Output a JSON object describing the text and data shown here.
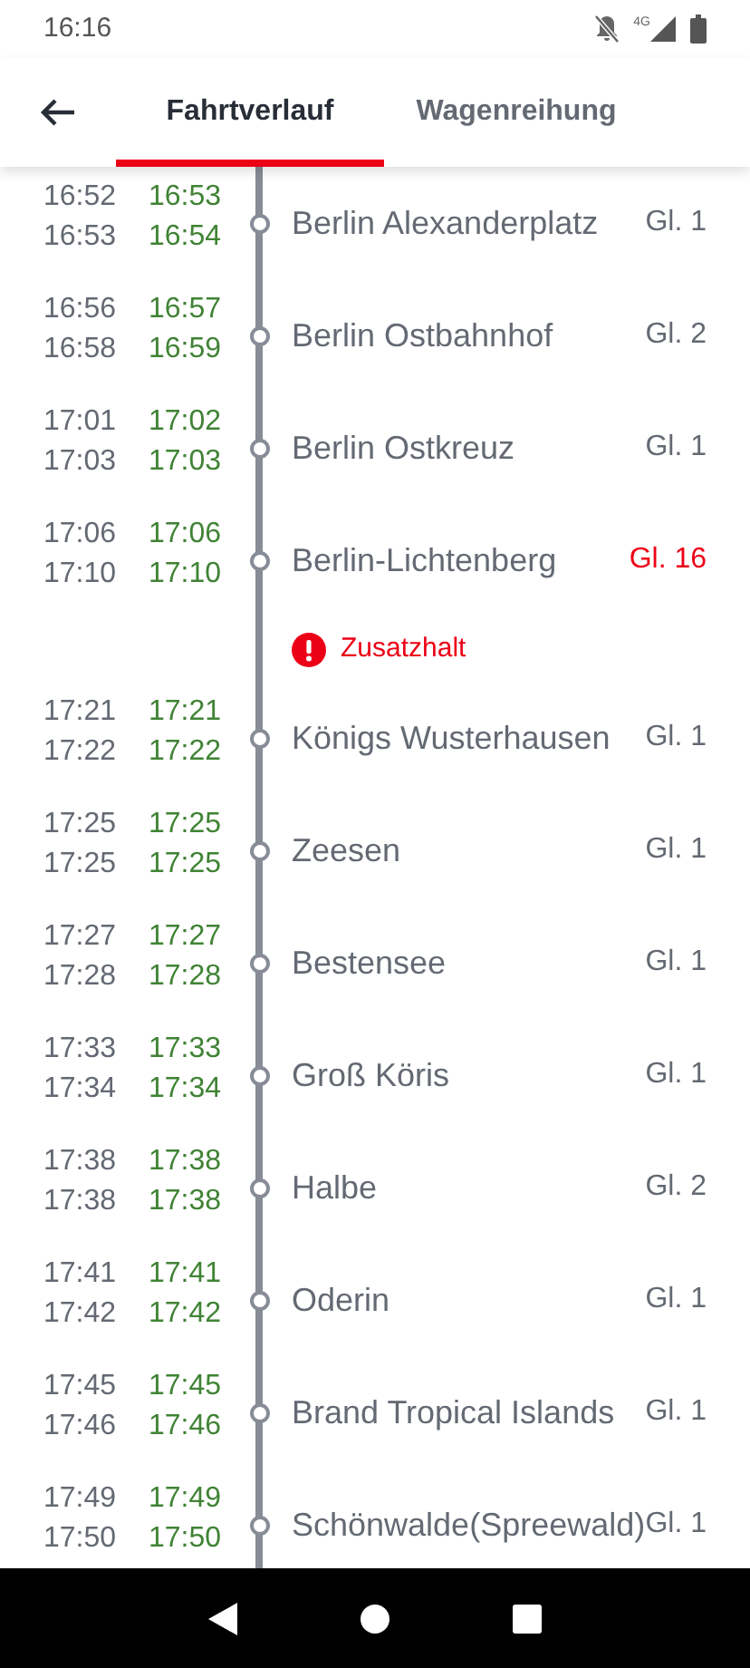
{
  "status_bar": {
    "time": "16:16",
    "network": "4G"
  },
  "tabs": [
    {
      "label": "Fahrtverlauf",
      "selected": true
    },
    {
      "label": "Wagenreihung",
      "selected": false
    }
  ],
  "stops": [
    {
      "arr_planned": "16:52",
      "arr_actual": "16:53",
      "dep_planned": "16:53",
      "dep_actual": "16:54",
      "station": "Berlin Alexanderplatz",
      "platform": "Gl. 1",
      "platform_changed": false
    },
    {
      "arr_planned": "16:56",
      "arr_actual": "16:57",
      "dep_planned": "16:58",
      "dep_actual": "16:59",
      "station": "Berlin Ostbahnhof",
      "platform": "Gl. 2",
      "platform_changed": false
    },
    {
      "arr_planned": "17:01",
      "arr_actual": "17:02",
      "dep_planned": "17:03",
      "dep_actual": "17:03",
      "station": "Berlin Ostkreuz",
      "platform": "Gl. 1",
      "platform_changed": false
    },
    {
      "arr_planned": "17:06",
      "arr_actual": "17:06",
      "dep_planned": "17:10",
      "dep_actual": "17:10",
      "station": "Berlin-Lichtenberg",
      "platform": "Gl. 16",
      "platform_changed": true,
      "note": {
        "kind": "warning",
        "text": "Zusatzhalt"
      }
    },
    {
      "arr_planned": "17:21",
      "arr_actual": "17:21",
      "dep_planned": "17:22",
      "dep_actual": "17:22",
      "station": "Königs Wusterhausen",
      "platform": "Gl. 1",
      "platform_changed": false
    },
    {
      "arr_planned": "17:25",
      "arr_actual": "17:25",
      "dep_planned": "17:25",
      "dep_actual": "17:25",
      "station": "Zeesen",
      "platform": "Gl. 1",
      "platform_changed": false
    },
    {
      "arr_planned": "17:27",
      "arr_actual": "17:27",
      "dep_planned": "17:28",
      "dep_actual": "17:28",
      "station": "Bestensee",
      "platform": "Gl. 1",
      "platform_changed": false
    },
    {
      "arr_planned": "17:33",
      "arr_actual": "17:33",
      "dep_planned": "17:34",
      "dep_actual": "17:34",
      "station": "Groß Köris",
      "platform": "Gl. 1",
      "platform_changed": false
    },
    {
      "arr_planned": "17:38",
      "arr_actual": "17:38",
      "dep_planned": "17:38",
      "dep_actual": "17:38",
      "station": "Halbe",
      "platform": "Gl. 2",
      "platform_changed": false
    },
    {
      "arr_planned": "17:41",
      "arr_actual": "17:41",
      "dep_planned": "17:42",
      "dep_actual": "17:42",
      "station": "Oderin",
      "platform": "Gl. 1",
      "platform_changed": false
    },
    {
      "arr_planned": "17:45",
      "arr_actual": "17:45",
      "dep_planned": "17:46",
      "dep_actual": "17:46",
      "station": "Brand Tropical Islands",
      "platform": "Gl. 1",
      "platform_changed": false
    },
    {
      "arr_planned": "17:49",
      "arr_actual": "17:49",
      "dep_planned": "17:50",
      "dep_actual": "17:50",
      "station": "Schönwalde(Spreewald)",
      "platform": "Gl. 1",
      "platform_changed": false
    }
  ]
}
